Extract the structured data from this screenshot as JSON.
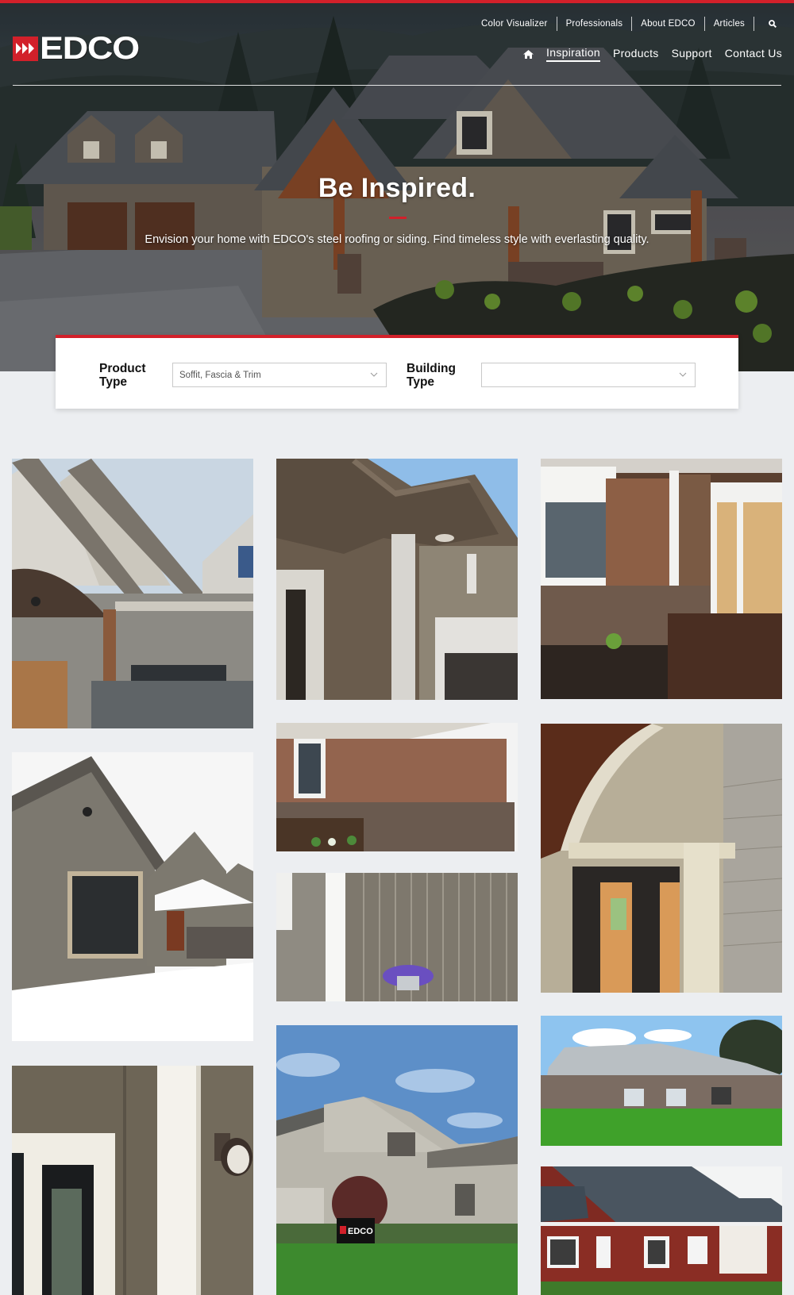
{
  "brand": {
    "name": "EDCO",
    "accent_color": "#d2202a"
  },
  "utility_nav": {
    "items": [
      {
        "label": "Color Visualizer"
      },
      {
        "label": "Professionals"
      },
      {
        "label": "About EDCO"
      },
      {
        "label": "Articles"
      }
    ],
    "search_icon": "search-icon"
  },
  "main_nav": {
    "home_icon": "home-icon",
    "items": [
      {
        "label": "Inspiration",
        "active": true
      },
      {
        "label": "Products",
        "active": false
      },
      {
        "label": "Support",
        "active": false
      },
      {
        "label": "Contact Us",
        "active": false
      }
    ]
  },
  "hero": {
    "title": "Be Inspired.",
    "subtitle": "Envision your home with EDCO's steel roofing or siding. Find timeless style with everlasting quality."
  },
  "filters": {
    "product_type": {
      "label_line1": "Product",
      "label_line2": "Type",
      "value": "Soffit, Fascia & Trim"
    },
    "building_type": {
      "label_line1": "Building",
      "label_line2": "Type",
      "value": ""
    }
  },
  "gallery": {
    "items": [
      {
        "description": "Craftsman home with gables, arched porch and stone base"
      },
      {
        "description": "Close-up of brown soffit and fascia with white trim"
      },
      {
        "description": "Brown lap siding with stone wainscot and wooden door"
      },
      {
        "description": "Gray home with gable windows in snow"
      },
      {
        "description": "Brown siding corner with stone planter"
      },
      {
        "description": "Curved porch soffit above sliding doors"
      },
      {
        "description": "Vertical board siding with hanging flower basket"
      },
      {
        "description": "Front entry with white column and wall lantern"
      },
      {
        "description": "Two-story home with EDCO yard sign"
      },
      {
        "description": "Large single-story home with green lawn"
      },
      {
        "description": "Red barn-style building with dark steel roof"
      }
    ],
    "sign_text": "EDCO"
  }
}
